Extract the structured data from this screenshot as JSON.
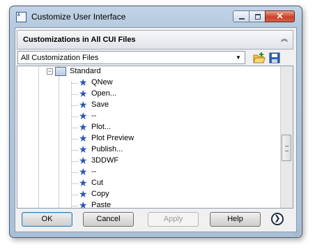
{
  "window": {
    "title": "Customize User Interface",
    "close_glyph": "✕"
  },
  "panel": {
    "title": "Customizations in All CUI Files",
    "collapse_glyph": "︽"
  },
  "dropdown": {
    "value": "All Customization Files",
    "arrow_glyph": "▼"
  },
  "tree": {
    "toolbar": {
      "label": "Standard",
      "expander": "−"
    },
    "items": [
      {
        "label": "QNew",
        "icon": "command-star-icon"
      },
      {
        "label": "Open...",
        "icon": "command-star-icon"
      },
      {
        "label": "Save",
        "icon": "command-star-icon"
      },
      {
        "label": "--",
        "icon": "command-star-icon"
      },
      {
        "label": "Plot...",
        "icon": "command-star-icon"
      },
      {
        "label": "Plot Preview",
        "icon": "command-star-icon"
      },
      {
        "label": "Publish...",
        "icon": "command-star-icon"
      },
      {
        "label": "3DDWF",
        "icon": "command-star-icon"
      },
      {
        "label": "--",
        "icon": "command-star-icon"
      },
      {
        "label": "Cut",
        "icon": "command-star-icon"
      },
      {
        "label": "Copy",
        "icon": "command-star-icon"
      },
      {
        "label": "Paste",
        "icon": "command-star-icon"
      }
    ]
  },
  "buttons": {
    "ok": "OK",
    "cancel": "Cancel",
    "apply": "Apply",
    "help": "Help",
    "expand_glyph": "❯"
  },
  "colors": {
    "frame": "#b5c9df",
    "star": "#2a56b8",
    "close_button": "#c7432a"
  }
}
